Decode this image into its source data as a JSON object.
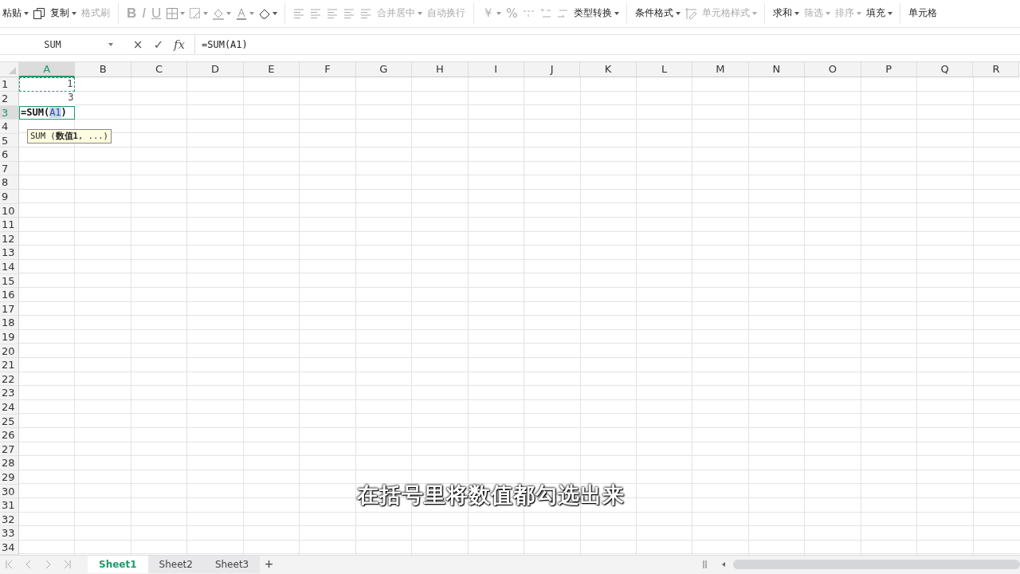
{
  "toolbar": {
    "paste": {
      "label": "粘贴"
    },
    "copy": {
      "label": "复制"
    },
    "format_painter": {
      "label": "格式刷",
      "disabled": true
    },
    "font": [
      "B",
      "I",
      "U"
    ],
    "merge": {
      "label": "合并居中",
      "disabled": true
    },
    "wrap": {
      "label": "自动换行",
      "disabled": true
    },
    "currency": "￥",
    "percent": "%",
    "type_convert": {
      "label": "类型转换"
    },
    "items": [
      {
        "label": "条件格式",
        "disabled": false,
        "dropdown": true
      },
      {
        "label": "单元格样式",
        "disabled": true,
        "dropdown": true
      },
      {
        "label": "求和",
        "disabled": false,
        "dropdown": true
      },
      {
        "label": "筛选",
        "disabled": true,
        "dropdown": true
      },
      {
        "label": "排序",
        "disabled": true,
        "dropdown": true
      },
      {
        "label": "填充",
        "disabled": false,
        "dropdown": true
      },
      {
        "label": "单元格",
        "disabled": false,
        "dropdown": false
      }
    ]
  },
  "formula_bar": {
    "name_box": "SUM",
    "cancel": "×",
    "confirm": "✓",
    "fx": "fx",
    "formula": "=SUM(A1)"
  },
  "columns": [
    {
      "label": "A",
      "selected": true
    },
    {
      "label": "B",
      "selected": false
    },
    {
      "label": "C",
      "selected": false
    },
    {
      "label": "D",
      "selected": false
    },
    {
      "label": "E",
      "selected": false
    },
    {
      "label": "F",
      "selected": false
    },
    {
      "label": "G",
      "selected": false
    },
    {
      "label": "H",
      "selected": false
    },
    {
      "label": "I",
      "selected": false
    },
    {
      "label": "J",
      "selected": false
    },
    {
      "label": "K",
      "selected": false
    },
    {
      "label": "L",
      "selected": false
    },
    {
      "label": "M",
      "selected": false
    },
    {
      "label": "N",
      "selected": false
    },
    {
      "label": "O",
      "selected": false
    },
    {
      "label": "P",
      "selected": false
    },
    {
      "label": "Q",
      "selected": false
    },
    {
      "label": "R",
      "selected": false
    }
  ],
  "rows": [
    {
      "label": "1",
      "selected": false,
      "cells": [
        {
          "kind": "value",
          "text": "1",
          "referenced": true,
          "selected": false
        }
      ]
    },
    {
      "label": "2",
      "selected": false,
      "cells": [
        {
          "kind": "value",
          "text": "3",
          "referenced": false,
          "selected": false
        }
      ]
    },
    {
      "label": "3",
      "selected": true,
      "cells": [
        {
          "kind": "editing",
          "before": "=SUM(",
          "reference": "A1",
          "after": ")",
          "referenced": false,
          "selected": true
        }
      ]
    },
    {
      "label": "4",
      "selected": false
    },
    {
      "label": "5",
      "selected": false
    },
    {
      "label": "6",
      "selected": false
    },
    {
      "label": "7",
      "selected": false
    },
    {
      "label": "8",
      "selected": false
    },
    {
      "label": "9",
      "selected": false
    },
    {
      "label": "10",
      "selected": false
    },
    {
      "label": "11",
      "selected": false
    },
    {
      "label": "12",
      "selected": false
    },
    {
      "label": "13",
      "selected": false
    },
    {
      "label": "14",
      "selected": false
    },
    {
      "label": "15",
      "selected": false
    },
    {
      "label": "16",
      "selected": false
    },
    {
      "label": "17",
      "selected": false
    },
    {
      "label": "18",
      "selected": false
    },
    {
      "label": "19",
      "selected": false
    },
    {
      "label": "20",
      "selected": false
    },
    {
      "label": "21",
      "selected": false
    },
    {
      "label": "22",
      "selected": false
    },
    {
      "label": "23",
      "selected": false
    },
    {
      "label": "24",
      "selected": false
    },
    {
      "label": "25",
      "selected": false
    },
    {
      "label": "26",
      "selected": false
    },
    {
      "label": "27",
      "selected": false
    },
    {
      "label": "28",
      "selected": false
    },
    {
      "label": "29",
      "selected": false
    },
    {
      "label": "30",
      "selected": false
    },
    {
      "label": "31",
      "selected": false
    },
    {
      "label": "32",
      "selected": false
    },
    {
      "label": "33",
      "selected": false
    },
    {
      "label": "34",
      "selected": false
    }
  ],
  "tooltip": "SUM (**数值1**, ...)",
  "sheet_tabs": [
    {
      "label": "Sheet1",
      "selected": true
    },
    {
      "label": "Sheet2",
      "selected": false
    },
    {
      "label": "Sheet3",
      "selected": false
    }
  ],
  "add_sheet": "+",
  "caption": "在括号里将数值都勾选出来"
}
